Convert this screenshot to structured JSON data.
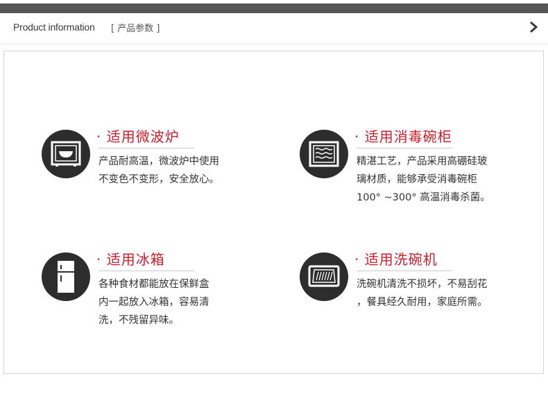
{
  "header": {
    "title": "Product information",
    "subtitle": "[ 产品参数 ]",
    "arrow_icon": "chevron-right-icon"
  },
  "features": [
    {
      "icon": "microwave-icon",
      "title": "· 适用微波炉",
      "lines": [
        "产品耐高温，微波炉中使用",
        "不变色不变形，安全放心。"
      ]
    },
    {
      "icon": "sterilizer-cabinet-icon",
      "title": "· 适用消毒碗柜",
      "lines": [
        "精湛工艺，产品采用高硼硅玻",
        "璃材质，能够承受消毒碗柜",
        "100° ~300° 高温消毒杀菌。"
      ]
    },
    {
      "icon": "refrigerator-icon",
      "title": "· 适用冰箱",
      "lines": [
        "各种食材都能放在保鲜盒",
        "内一起放入冰箱，容易清",
        "洗，不残留异味。"
      ]
    },
    {
      "icon": "dishwasher-icon",
      "title": "· 适用洗碗机",
      "lines": [
        "洗碗机清洗不损坏，不易刮花",
        "，餐具经久耐用，家庭所需。"
      ]
    }
  ],
  "colors": {
    "accent": "#cf1c2a",
    "top_bar": "#565656",
    "icon_bg": "#2d2d2d"
  }
}
